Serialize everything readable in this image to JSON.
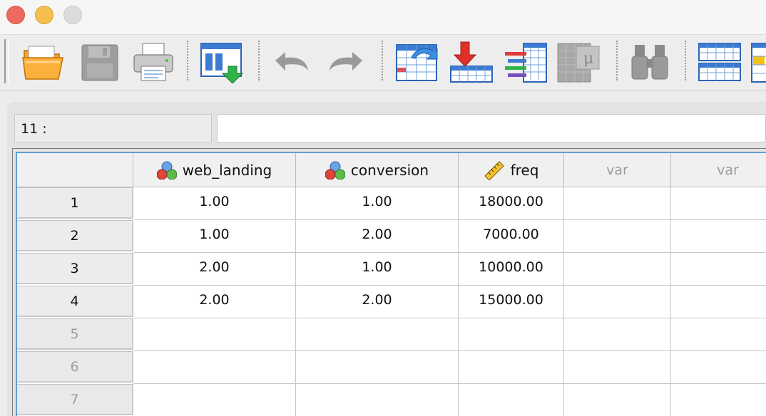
{
  "window": {
    "buttons": [
      "close",
      "minimize",
      "zoom"
    ]
  },
  "toolbar": {
    "buttons": [
      {
        "name": "open-folder-icon",
        "enabled": true
      },
      {
        "name": "save-disk-icon",
        "enabled": false
      },
      {
        "name": "print-icon",
        "enabled": true
      },
      {
        "name": "dialog-recall-icon",
        "enabled": true
      },
      {
        "name": "undo-icon",
        "enabled": false
      },
      {
        "name": "redo-icon",
        "enabled": false
      },
      {
        "name": "goto-case-icon",
        "enabled": true
      },
      {
        "name": "goto-variable-icon",
        "enabled": true
      },
      {
        "name": "variables-icon",
        "enabled": true
      },
      {
        "name": "run-descriptives-icon",
        "enabled": false
      },
      {
        "name": "find-binoculars-icon",
        "enabled": false
      },
      {
        "name": "split-file-icon",
        "enabled": true
      },
      {
        "name": "weight-cases-icon",
        "enabled": true
      }
    ]
  },
  "cell_editor": {
    "reference": "11 :",
    "value": ""
  },
  "grid": {
    "columns": [
      {
        "label": "web_landing",
        "type": "nominal"
      },
      {
        "label": "conversion",
        "type": "nominal"
      },
      {
        "label": "freq",
        "type": "scale"
      },
      {
        "label": "var",
        "type": "empty"
      },
      {
        "label": "var",
        "type": "empty"
      }
    ],
    "rows": [
      {
        "num": "1",
        "cells": [
          "1.00",
          "1.00",
          "18000.00",
          "",
          ""
        ]
      },
      {
        "num": "2",
        "cells": [
          "1.00",
          "2.00",
          "7000.00",
          "",
          ""
        ]
      },
      {
        "num": "3",
        "cells": [
          "2.00",
          "1.00",
          "10000.00",
          "",
          ""
        ]
      },
      {
        "num": "4",
        "cells": [
          "2.00",
          "2.00",
          "15000.00",
          "",
          ""
        ]
      },
      {
        "num": "5",
        "cells": [
          "",
          "",
          "",
          "",
          ""
        ]
      },
      {
        "num": "6",
        "cells": [
          "",
          "",
          "",
          "",
          ""
        ]
      },
      {
        "num": "7",
        "cells": [
          "",
          "",
          "",
          "",
          ""
        ]
      }
    ],
    "filled_rows": 4
  },
  "colors": {
    "close": "#ee6a5e",
    "minimize": "#f5bf4f",
    "zoom": "#dcdcdc",
    "grid_accent": "#5e9ed6"
  }
}
